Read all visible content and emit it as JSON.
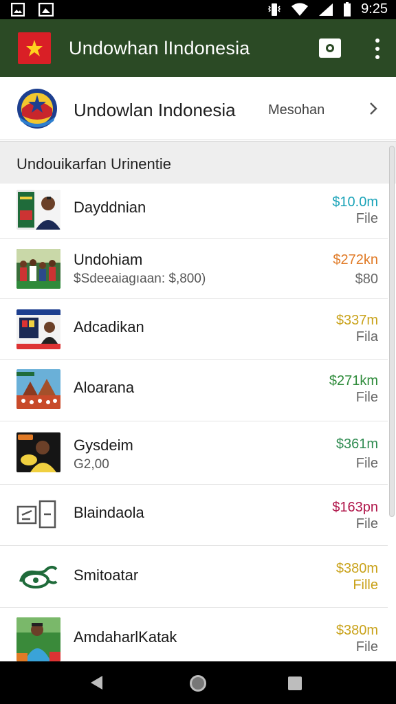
{
  "status_bar": {
    "time": "9:25",
    "icons": [
      "image-icon",
      "gallery-icon",
      "vibrate-icon",
      "wifi-icon",
      "signal-icon",
      "battery-icon"
    ]
  },
  "app_bar": {
    "title": "Undowhan lIndonesia",
    "icons": [
      "flag-star-icon",
      "camera-icon",
      "overflow-menu-icon"
    ]
  },
  "header_card": {
    "title": "Undowlan Indonesia",
    "link": "Mesohan",
    "icons": [
      "emblem-icon",
      "chevron-right-icon"
    ]
  },
  "section": {
    "title": "Undouikarfan Urinentie"
  },
  "items": [
    {
      "title": "Dayddnian",
      "subtitle": "",
      "price": "$10.0m",
      "price_color": "#1aa3b8",
      "note": "File",
      "thumb": "thumb-book-man"
    },
    {
      "title": "Undohiam",
      "subtitle": "$Sdeeaiagıaan: $,800)",
      "price": "$272kn",
      "price_color": "#e07a26",
      "note": "$80",
      "thumb": "thumb-crowd"
    },
    {
      "title": "Adcadikan",
      "subtitle": "",
      "price": "$337m",
      "price_color": "#c9a21a",
      "note": "Fila",
      "thumb": "thumb-poster"
    },
    {
      "title": "Aloarana",
      "subtitle": "",
      "price": "$271km",
      "price_color": "#2e8b3a",
      "note": "File",
      "thumb": "thumb-temple"
    },
    {
      "title": "Gysdeim",
      "subtitle": "G2,00",
      "price": "$361m",
      "price_color": "#2e8b50",
      "note": "File",
      "thumb": "thumb-person-dark"
    },
    {
      "title": "Blaindaola",
      "subtitle": "",
      "price": "$163pn",
      "price_color": "#b0164a",
      "note": "File",
      "thumb": "document-icon"
    },
    {
      "title": "Smitoatar",
      "subtitle": "",
      "price": "$380m",
      "price_color": "#c9a21a",
      "note": "Fille",
      "thumb": "money-wing-icon"
    },
    {
      "title": "AmdaharlKatak",
      "subtitle": "",
      "price": "$380m",
      "price_color": "#c9a21a",
      "note": "File",
      "thumb": "thumb-boy"
    }
  ],
  "nav_bar": {
    "icons": [
      "back-icon",
      "home-icon",
      "recents-icon"
    ]
  }
}
